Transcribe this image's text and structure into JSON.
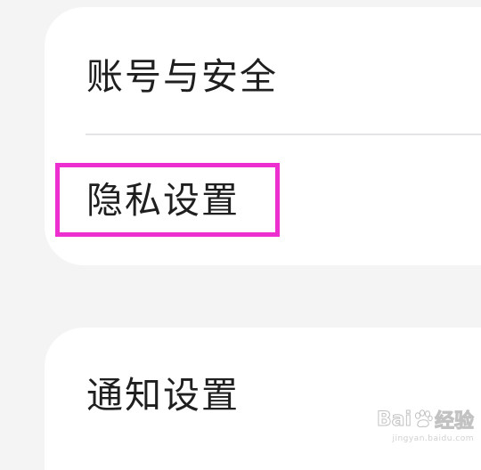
{
  "settings": {
    "group_1": {
      "items": [
        {
          "label": "账号与安全"
        },
        {
          "label": "隐私设置"
        }
      ]
    },
    "group_2": {
      "items": [
        {
          "label": "通知设置"
        }
      ]
    }
  },
  "annotation": {
    "highlight_color": "#ee2fd0"
  },
  "watermark": {
    "brand_left": "Bai",
    "brand_right": "经验",
    "url": "jingyan.baidu.com"
  }
}
